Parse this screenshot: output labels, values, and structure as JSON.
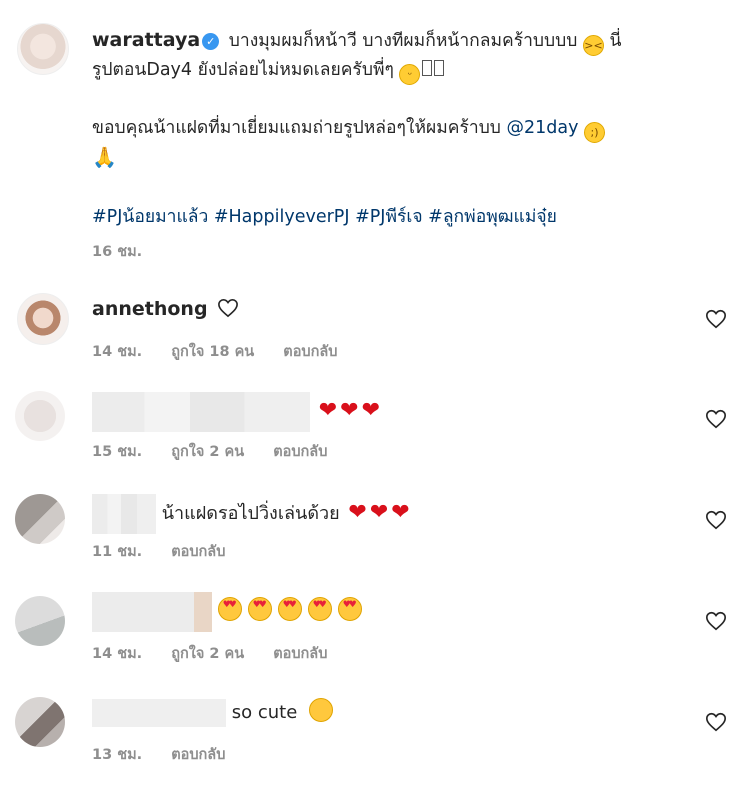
{
  "post": {
    "username": "warattaya",
    "caption_line1": "บางมุมผมก็หน้าวี บางทีผมก็หน้ากลมคร้าบบบบ",
    "caption_line1b": "นี่",
    "caption_line2": "รูปตอนDay4 ยังปล่อยไม่หมดเลยครับพี่ๆ",
    "caption_line3": "ขอบคุณน้าแฝดที่มาเยี่ยมแถมถ่ายรูปหล่อๆให้ผมคร้าบบ",
    "mention": "@21day",
    "hashtags": "#PJน้อยมาแล้ว #HappilyeverPJ #PJพีร์เจ #ลูกพ่อพุฒแม่จุ๋ย",
    "time": "16 ชม."
  },
  "comments": [
    {
      "username": "annethong",
      "text": "",
      "time": "14 ชม.",
      "likes": "ถูกใจ 18 คน",
      "reply": "ตอบกลับ"
    },
    {
      "username": "",
      "text": "",
      "time": "15 ชม.",
      "likes": "ถูกใจ 2 คน",
      "reply": "ตอบกลับ"
    },
    {
      "username": "",
      "text": "น้าแฝดรอไปวิ่งเล่นด้วย",
      "time": "11 ชม.",
      "likes": "",
      "reply": "ตอบกลับ"
    },
    {
      "username": "",
      "text": "",
      "time": "14 ชม.",
      "likes": "ถูกใจ 2 คน",
      "reply": "ตอบกลับ"
    },
    {
      "username": "",
      "text": "so cute",
      "time": "13 ชม.",
      "likes": "",
      "reply": "ตอบกลับ"
    }
  ],
  "icons": {
    "like": "heart-outline-icon",
    "verified": "verified-badge-icon"
  },
  "colors": {
    "link": "#00376b",
    "meta": "#8e8e8e",
    "verified": "#3897f0"
  }
}
